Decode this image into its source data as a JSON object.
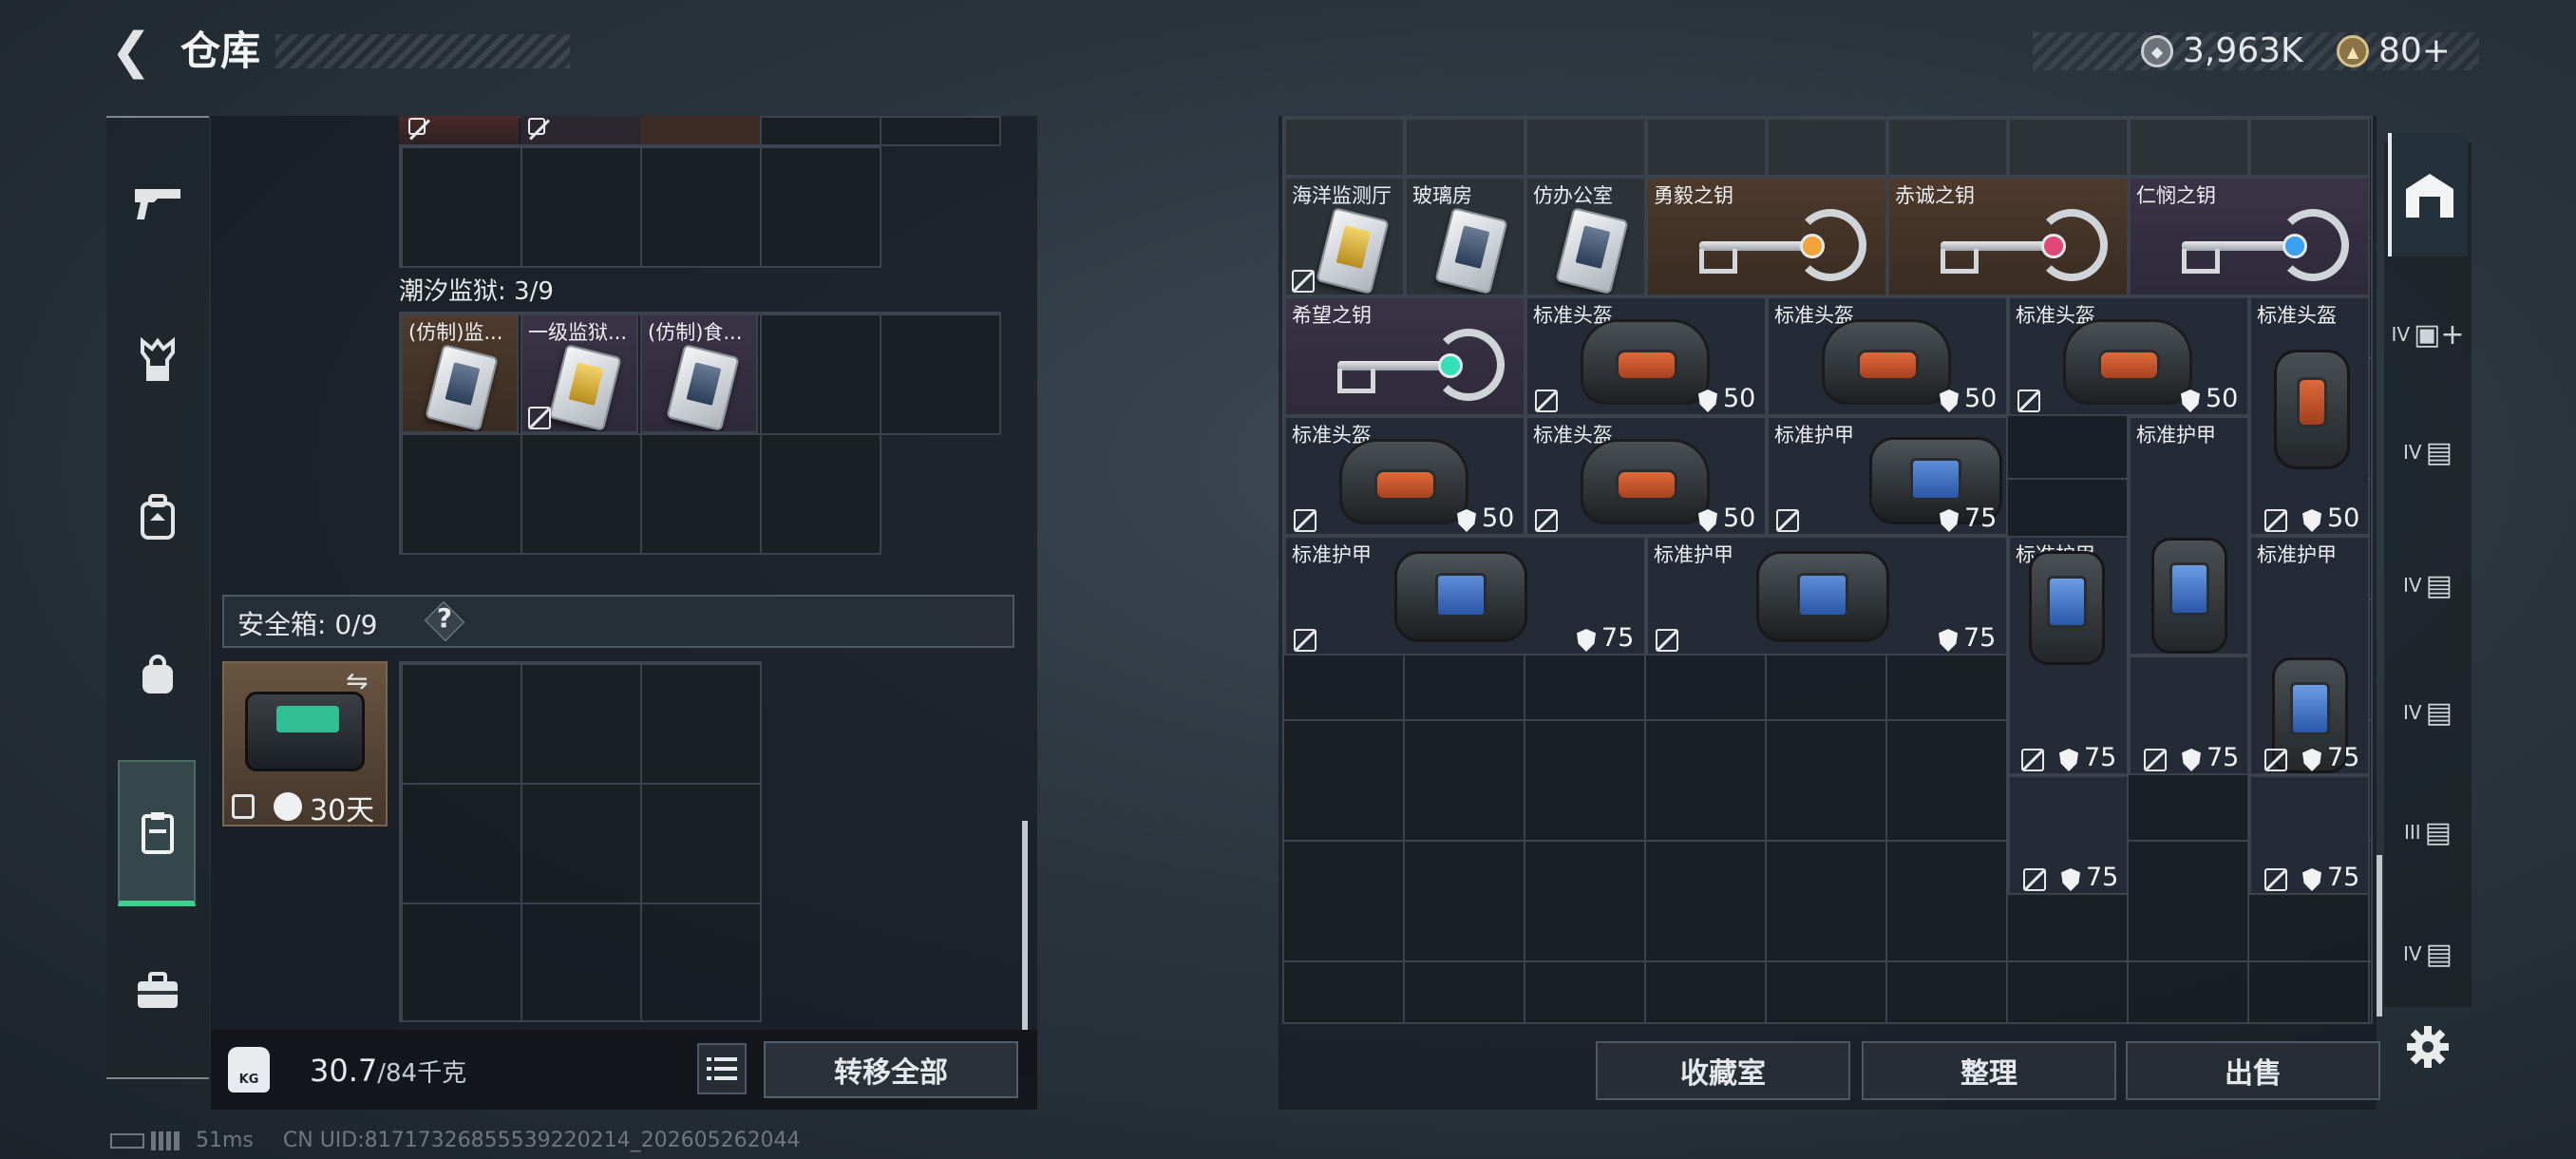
{
  "header": {
    "back_icon": "back-arrow-icon",
    "title": "仓库"
  },
  "currency": {
    "silver_icon": "silver-coin-icon",
    "silver": "3,963K",
    "gold_icon": "gold-coin-icon",
    "gold": "80+"
  },
  "nav": {
    "items": [
      {
        "name": "weapons",
        "icon": "gun-icon"
      },
      {
        "name": "armor",
        "icon": "armor-vest-icon"
      },
      {
        "name": "backpack",
        "icon": "backpack-icon"
      },
      {
        "name": "bag",
        "icon": "bag-icon"
      },
      {
        "name": "safe-box",
        "icon": "safe-box-icon"
      },
      {
        "name": "toolbox",
        "icon": "toolbox-icon"
      }
    ]
  },
  "left": {
    "section_prison": "潮汐监狱: 3/9",
    "prison_items": [
      {
        "label": "(仿制)监...",
        "color": "brown",
        "locked": false
      },
      {
        "label": "一级监狱...",
        "color": "purple",
        "locked": true
      },
      {
        "label": "(仿制)食...",
        "color": "purple",
        "locked": false
      }
    ],
    "safe_title": "安全箱: 0/9",
    "safe_help": "?",
    "safe_timer": "30天",
    "weight": "30.7",
    "weight_max": "/84千克",
    "weight_icon_text": "KG",
    "transfer_all": "转移全部"
  },
  "status": {
    "ping": "51ms",
    "uid": "CN UID:81717326855539220214_202605262044"
  },
  "storage": {
    "row_labels": [
      {
        "text": "海洋监测厅"
      },
      {
        "text": "玻璃房"
      },
      {
        "text": "仿办公室"
      },
      {
        "text": "勇毅之钥"
      },
      {
        "text": "赤诚之钥"
      },
      {
        "text": "仁悯之钥"
      },
      {
        "text": "希望之钥"
      },
      {
        "text": "标准头盔"
      },
      {
        "text": "标准头盔"
      },
      {
        "text": "标准头盔"
      },
      {
        "text": "标准头盔"
      },
      {
        "text": "标准头盔"
      },
      {
        "text": "标准头盔"
      },
      {
        "text": "标准护甲"
      },
      {
        "text": "标准护甲"
      },
      {
        "text": "标准护甲"
      },
      {
        "text": "标准护甲"
      },
      {
        "text": "标准护甲"
      },
      {
        "text": "标准护甲"
      }
    ],
    "durability": [
      "50",
      "50",
      "50",
      "50",
      "50",
      "75",
      "50",
      "75",
      "75",
      "75",
      "75",
      "75",
      "75"
    ],
    "gem_colors": {
      "brave": "#f2a33a",
      "sincere": "#e2477a",
      "mercy": "#3aa0f0",
      "hope": "#34e0b8"
    }
  },
  "actions": {
    "collection": "收藏室",
    "organize": "整理",
    "sell": "出售"
  },
  "right_sidebar": [
    {
      "icon": "storage-home-icon",
      "tier": ""
    },
    {
      "icon": "add-storage-icon",
      "tier": "IV"
    },
    {
      "icon": "storage-tab-icon",
      "tier": "IV"
    },
    {
      "icon": "storage-tab-icon",
      "tier": "IV"
    },
    {
      "icon": "storage-tab-icon",
      "tier": "IV"
    },
    {
      "icon": "storage-tab-icon",
      "tier": "III"
    },
    {
      "icon": "storage-tab-icon",
      "tier": "IV"
    },
    {
      "icon": "settings-gear-icon",
      "tier": ""
    }
  ]
}
